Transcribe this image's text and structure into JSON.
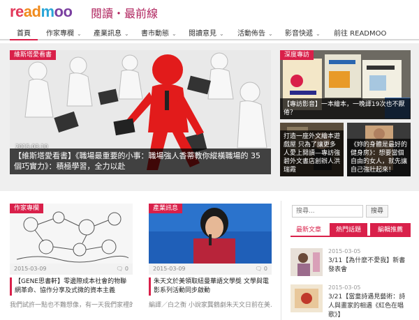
{
  "header": {
    "logo_parts": [
      "re",
      "ad",
      "m",
      "oo"
    ],
    "tagline": "閱讀・最前線"
  },
  "nav": {
    "items": [
      {
        "label": "首頁",
        "has_dropdown": false
      },
      {
        "label": "作家專欄",
        "has_dropdown": true
      },
      {
        "label": "產業訊息",
        "has_dropdown": true
      },
      {
        "label": "書市動態",
        "has_dropdown": true
      },
      {
        "label": "閱讀意見",
        "has_dropdown": true
      },
      {
        "label": "活動佈告",
        "has_dropdown": true
      },
      {
        "label": "影音快遞",
        "has_dropdown": true
      },
      {
        "label": "前往 READMOO",
        "has_dropdown": false
      }
    ],
    "chevron": "⌄"
  },
  "feature": {
    "tag": "維斯塔愛看書",
    "date": "2015-03-10",
    "title": "【維斯塔愛看書】《職場最重要的小事：職場強人香蒂教你縱橫職場的 35 個巧實力》：積極學習，全力以赴"
  },
  "right_top": {
    "tag": "深度專訪",
    "caption": "【專訪影音】一本繪本，一晚譯19次也不厭倦？"
  },
  "right_small": [
    {
      "caption": "打造一座外文繪本遊戲屋 只為了讓更多人愛上閱讀—專訪強碧外文書店創辦人洪瑞霞"
    },
    {
      "caption": "《妳的身體是最好的健身房》：想要當個自由的女人，就先讓自己強壯起來！"
    }
  ],
  "cards": [
    {
      "tag": "作家專欄",
      "date": "2015-03-09",
      "comments": "0",
      "title": "【GENE思書軒】零邊際成本社會的物聯網革命、協作分享及式微的資本主義",
      "excerpt": "我們試許一點也不難想像，有一天我們家裡的"
    },
    {
      "tag": "產業訊息",
      "date": "2015-03-09",
      "comments": "0",
      "title": "朱天文於美領取紐曼華語文學獎 文學與電影系列活動同步啟動",
      "excerpt": "編譯／白之衡 小說家龔鶴劇朱天文日前在美…"
    }
  ],
  "sidebar": {
    "search_placeholder": "搜尋...",
    "search_button": "搜尋",
    "tabs": [
      "最新文章",
      "熱門話題",
      "編輯推薦"
    ],
    "items": [
      {
        "date": "2015-03-05",
        "title": "3/11【為什麼不愛我】新書發表會"
      },
      {
        "date": "2015-03-05",
        "title": "3/21【當童詩遇見藝術：詩人與畫家的相遇《紅色在唱歌》】"
      }
    ]
  },
  "icons": {
    "comment": "comment-icon"
  },
  "colors": {
    "accent": "#d9204a",
    "tagline": "#b0245e"
  }
}
